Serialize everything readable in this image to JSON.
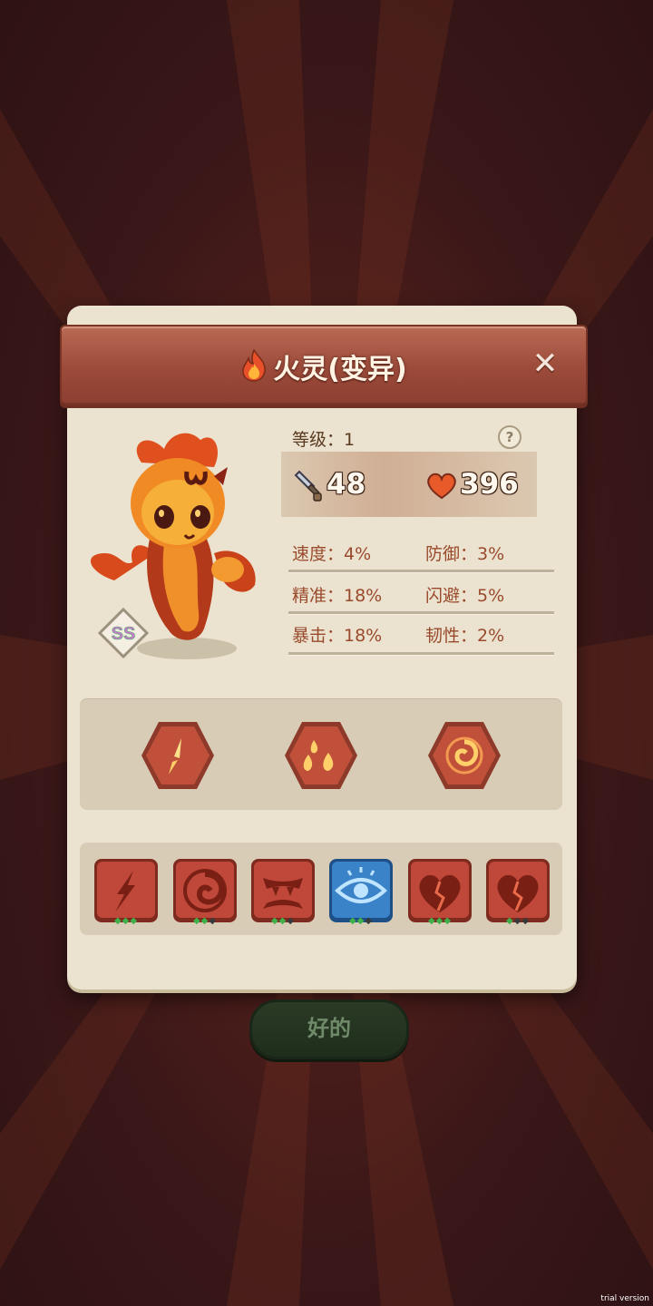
{
  "title": "火灵(变异)",
  "close_label": "✕",
  "level_text": "等级：1",
  "help_label": "?",
  "attack": "48",
  "hp": "396",
  "attributes": {
    "speed": "速度：4%",
    "defense": "防御：3%",
    "accuracy": "精准：18%",
    "evasion": "闪避：5%",
    "crit": "暴击：18%",
    "toughness": "韧性：2%"
  },
  "rank_badge": "SS",
  "skills": [
    {
      "icon": "crystal-shard-icon"
    },
    {
      "icon": "flame-drops-icon"
    },
    {
      "icon": "fire-swirl-icon"
    }
  ],
  "runes": [
    {
      "icon": "slash-icon",
      "color": "#c0483a",
      "dots": [
        "green",
        "green",
        "green"
      ]
    },
    {
      "icon": "swirl-icon",
      "color": "#c0483a",
      "dots": [
        "green",
        "green",
        "dark"
      ]
    },
    {
      "icon": "fangs-icon",
      "color": "#c0483a",
      "dots": [
        "green",
        "green",
        "dark"
      ]
    },
    {
      "icon": "eye-icon",
      "color": "#3a83c8",
      "dots": [
        "green",
        "green",
        "dark"
      ]
    },
    {
      "icon": "broken-heart-icon",
      "color": "#c0483a",
      "dots": [
        "green",
        "green",
        "green"
      ]
    },
    {
      "icon": "broken-heart-icon",
      "color": "#c0483a",
      "dots": [
        "green",
        "dark",
        "dark"
      ]
    }
  ],
  "ok_label": "好的",
  "watermark": "trial version"
}
